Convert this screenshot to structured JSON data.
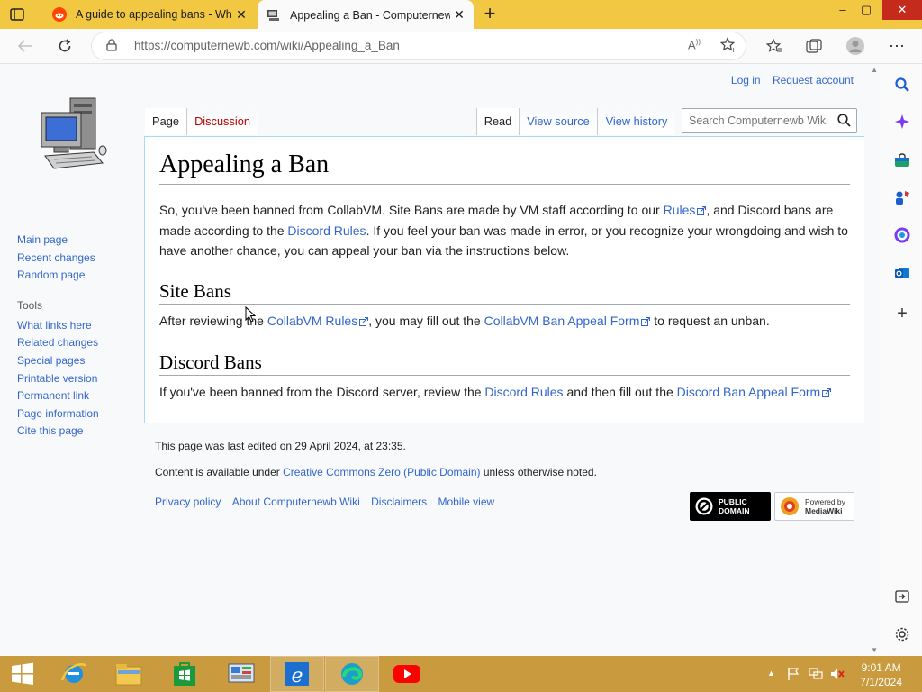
{
  "browser": {
    "tabs": [
      {
        "title": "A guide to appealing bans - Whe",
        "active": false
      },
      {
        "title": "Appealing a Ban - Computernewb",
        "active": true
      }
    ],
    "url": "https://computernewb.com/wiki/Appealing_a_Ban",
    "window_controls": {
      "minimize": "–",
      "maximize": "▢",
      "close": "✕"
    }
  },
  "wiki": {
    "user_links": [
      "Log in",
      "Request account"
    ],
    "page_tabs": {
      "left": [
        "Page",
        "Discussion"
      ],
      "right": [
        "Read",
        "View source",
        "View history"
      ]
    },
    "search_placeholder": "Search Computernewb Wiki",
    "nav": [
      "Main page",
      "Recent changes",
      "Random page"
    ],
    "tools_header": "Tools",
    "tools": [
      "What links here",
      "Related changes",
      "Special pages",
      "Printable version",
      "Permanent link",
      "Page information",
      "Cite this page"
    ],
    "title": "Appealing a Ban",
    "intro": {
      "t1": "So, you've been banned from CollabVM. Site Bans are made by VM staff according to our ",
      "l1": "Rules",
      "t2": ", and Discord bans are made according to the ",
      "l2": "Discord Rules",
      "t3": ". If you feel your ban was made in error, or you recognize your wrongdoing and wish to have another chance, you can appeal your ban via the instructions below."
    },
    "site_bans": {
      "heading": "Site Bans",
      "t1": "After reviewing the ",
      "l1": "CollabVM Rules",
      "t2": ", you may fill out the ",
      "l2": "CollabVM Ban Appeal Form",
      "t3": " to request an unban."
    },
    "discord_bans": {
      "heading": "Discord Bans",
      "t1": "If you've been banned from the Discord server, review the ",
      "l1": "Discord Rules",
      "t2": " and then fill out the ",
      "l2": "Discord Ban Appeal Form"
    },
    "footer": {
      "last_edited": "This page was last edited on 29 April 2024, at 23:35.",
      "license_t1": "Content is available under ",
      "license_link": "Creative Commons Zero (Public Domain)",
      "license_t2": " unless otherwise noted.",
      "links": [
        "Privacy policy",
        "About Computernewb Wiki",
        "Disclaimers",
        "Mobile view"
      ],
      "badge1": {
        "l1": "PUBLIC",
        "l2": "DOMAIN"
      },
      "badge2": {
        "l1": "Powered by",
        "l2": "MediaWiki"
      }
    }
  },
  "taskbar": {
    "time": "9:01 AM",
    "date": "7/1/2024"
  },
  "colors": {
    "link": "#3366cc",
    "titlebar": "#f2c843",
    "taskbar": "#c99a3e",
    "discussion_tab": "#ba0000"
  }
}
